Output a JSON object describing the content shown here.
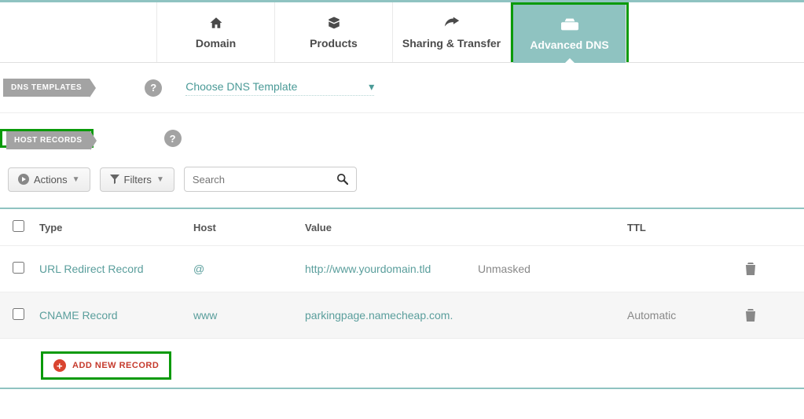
{
  "tabs": {
    "domain": "Domain",
    "products": "Products",
    "sharing": "Sharing & Transfer",
    "advanced": "Advanced DNS"
  },
  "sections": {
    "dns_templates": "DNS TEMPLATES",
    "host_records": "HOST RECORDS"
  },
  "dns_template_select": "Choose DNS Template",
  "toolbar": {
    "actions": "Actions",
    "filters": "Filters",
    "search_placeholder": "Search"
  },
  "headers": {
    "type": "Type",
    "host": "Host",
    "value": "Value",
    "ttl": "TTL"
  },
  "rows": [
    {
      "type": "URL Redirect Record",
      "host": "@",
      "value": "http://www.yourdomain.tld",
      "mask": "Unmasked",
      "ttl": ""
    },
    {
      "type": "CNAME Record",
      "host": "www",
      "value": "parkingpage.namecheap.com.",
      "mask": "",
      "ttl": "Automatic"
    }
  ],
  "add_new": "ADD NEW RECORD"
}
